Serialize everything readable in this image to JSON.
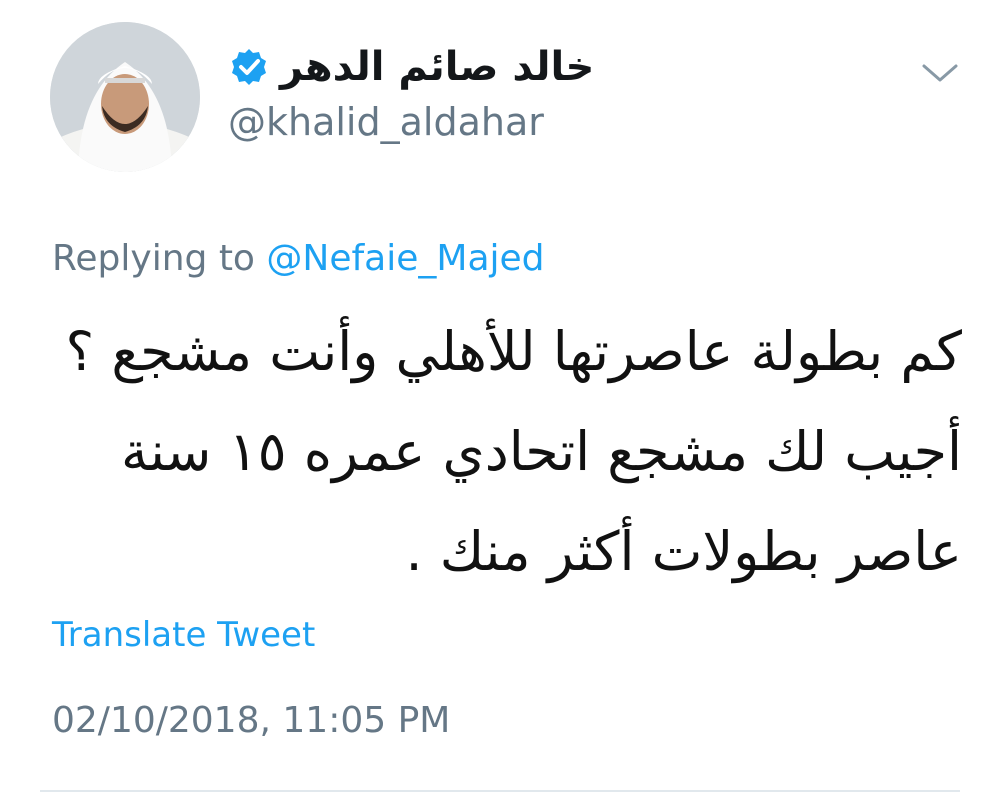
{
  "author": {
    "display_name": "خالد صائم الدهر",
    "handle": "@khalid_aldahar",
    "verified": true
  },
  "reply": {
    "prefix": "Replying to",
    "mention": "@Nefaie_Majed"
  },
  "tweet": {
    "lines": [
      "كم بطولة عاصرتها للأهلي وأنت مشجع ؟",
      "أجيب لك مشجع اتحادي عمره ١٥ سنة",
      "عاصر بطولات أكثر منك ."
    ]
  },
  "translate_label": "Translate Tweet",
  "timestamp": "02/10/2018, 11:05 PM",
  "icons": {
    "verified": "verified-badge-icon",
    "menu": "chevron-down-icon"
  },
  "colors": {
    "link": "#1da1f2",
    "secondary_text": "#657786",
    "primary_text": "#14171a"
  }
}
